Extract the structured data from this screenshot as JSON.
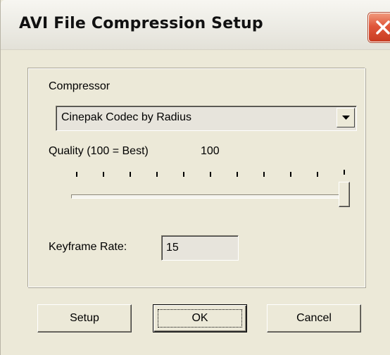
{
  "window": {
    "title": "AVI File Compression Setup"
  },
  "icons": {
    "close": "close-icon",
    "dropdown": "chevron-down-icon"
  },
  "colors": {
    "close_button": "#e0563a",
    "dialog_background": "#ece9d8"
  },
  "compressor": {
    "label": "Compressor",
    "selected": "Cinepak Codec by Radius"
  },
  "quality": {
    "label": "Quality (100 = Best)",
    "value_text": "100",
    "slider_value": 100,
    "slider_min": 0,
    "slider_max": 100
  },
  "keyframe": {
    "label": "Keyframe Rate:",
    "value": "15"
  },
  "buttons": {
    "setup": "Setup",
    "ok": "OK",
    "cancel": "Cancel"
  }
}
